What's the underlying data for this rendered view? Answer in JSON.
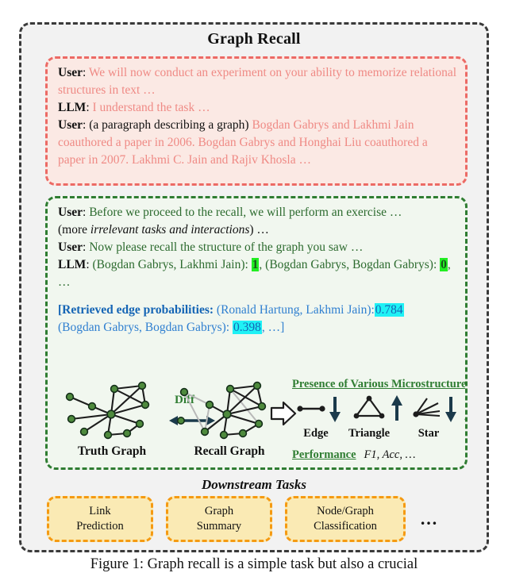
{
  "figure": {
    "title": "Graph Recall",
    "caption": "Figure 1: Graph recall is a simple task but also a crucial"
  },
  "red_box": {
    "lines": [
      {
        "speaker": "User",
        "sep": ": ",
        "text": "We will now conduct an experiment on your ability to memorize relational structures in text …"
      },
      {
        "speaker": "LLM",
        "sep": ": ",
        "text": "I understand the task …"
      },
      {
        "speaker": "User",
        "sep": ": ",
        "black_prefix": "(a paragraph describing a graph) ",
        "text": "Bogdan Gabrys and Lakhmi Jain coauthored a paper in 2006. Bogdan Gabrys and Honghai Liu coauthored a paper in 2007. Lakhmi C. Jain and Rajiv Khosla …"
      }
    ],
    "text_color": "#ef8a85",
    "border_color": "#ec6a65",
    "bg_color": "#fbe9e4"
  },
  "green_box": {
    "border_color": "#2f7d32",
    "bg_color": "#f1f7ef",
    "text_color": "#2d6b2f",
    "lines": [
      {
        "speaker": "User",
        "sep": ": ",
        "text": "Before we proceed to the recall, we will perform an exercise …"
      },
      {
        "black_prefix": "(more ",
        "italic": "irrelevant tasks and interactions",
        "black_suffix": ") …"
      },
      {
        "speaker": "User",
        "sep": ": ",
        "text": "Now please recall the structure of the graph you saw …"
      }
    ],
    "llm_line": {
      "speaker": "LLM",
      "sep": ": ",
      "pair1": "(Bogdan Gabrys, Lakhmi Jain): ",
      "val1": "1",
      "mid": ", (Bogdan Gabrys, Bogdan Gabrys): ",
      "val2": "0",
      "tail": ", …",
      "highlight_color": "#22ee22"
    },
    "probabilities": {
      "open_bracket": "[",
      "label": "Retrieved edge probabilities",
      "sep": ": ",
      "pair1": "(Ronald Hartung, Lakhmi Jain):",
      "val1": "0.784",
      "pair2": "(Bogdan Gabrys, Bogdan Gabrys): ",
      "val2": "0.398",
      "tail": ", …]",
      "highlight_color": "#1ff1f5",
      "text_color": "#2f7fd0"
    }
  },
  "diagram": {
    "truth_graph_label": "Truth Graph",
    "recall_graph_label": "Recall Graph",
    "diff_label": "Diff",
    "microstructures_heading": "Presence of Various Microstructures",
    "microstructures": [
      {
        "name": "Edge",
        "trend": "down"
      },
      {
        "name": "Triangle",
        "trend": "up"
      },
      {
        "name": "Star",
        "trend": "down"
      }
    ],
    "micro_ellipsis": "…",
    "performance_label": "Performance",
    "performance_values": "F1, Acc, …"
  },
  "downstream": {
    "title": "Downstream Tasks",
    "cards": [
      {
        "line1": "Link",
        "line2": "Prediction"
      },
      {
        "line1": "Graph",
        "line2": "Summary"
      },
      {
        "line1": "Node/Graph",
        "line2": "Classification"
      }
    ],
    "ellipsis": "…",
    "card_bg": "#faeab4",
    "card_border": "#f59a12"
  }
}
